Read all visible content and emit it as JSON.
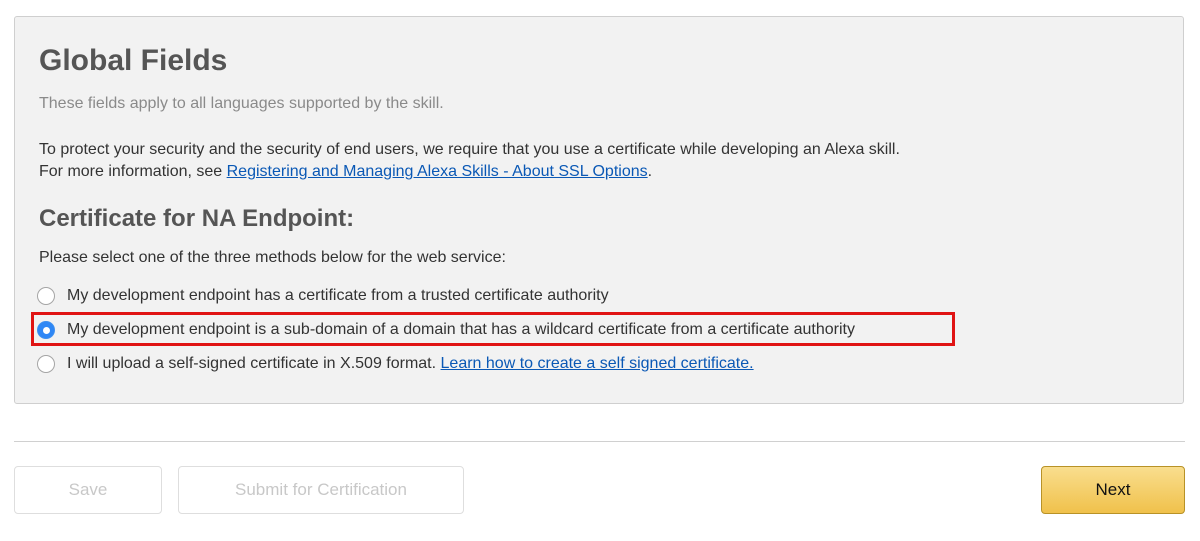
{
  "panel": {
    "title": "Global Fields",
    "subtitle": "These fields apply to all languages supported by the skill.",
    "description_line1": "To protect your security and the security of end users, we require that you use a certificate while developing an Alexa skill.",
    "description_line2_prefix": "For more information, see ",
    "description_link": "Registering and Managing Alexa Skills - About SSL Options",
    "description_line2_suffix": "."
  },
  "certificate": {
    "section_title": "Certificate for NA Endpoint:",
    "instruction": "Please select one of the three methods below for the web service:",
    "options": [
      {
        "label": "My development endpoint has a certificate from a trusted certificate authority",
        "selected": false
      },
      {
        "label": "My development endpoint is a sub-domain of a domain that has a wildcard certificate from a certificate authority",
        "selected": true
      },
      {
        "label": "I will upload a self-signed certificate in X.509 format. ",
        "link": "Learn how to create a self signed certificate.",
        "selected": false
      }
    ],
    "highlight_color": "#e01414"
  },
  "footer": {
    "save_label": "Save",
    "submit_label": "Submit for Certification",
    "next_label": "Next"
  },
  "colors": {
    "accent_radio": "#2f87f5",
    "link": "#0a58b5",
    "next_button": "#f0c14b"
  }
}
